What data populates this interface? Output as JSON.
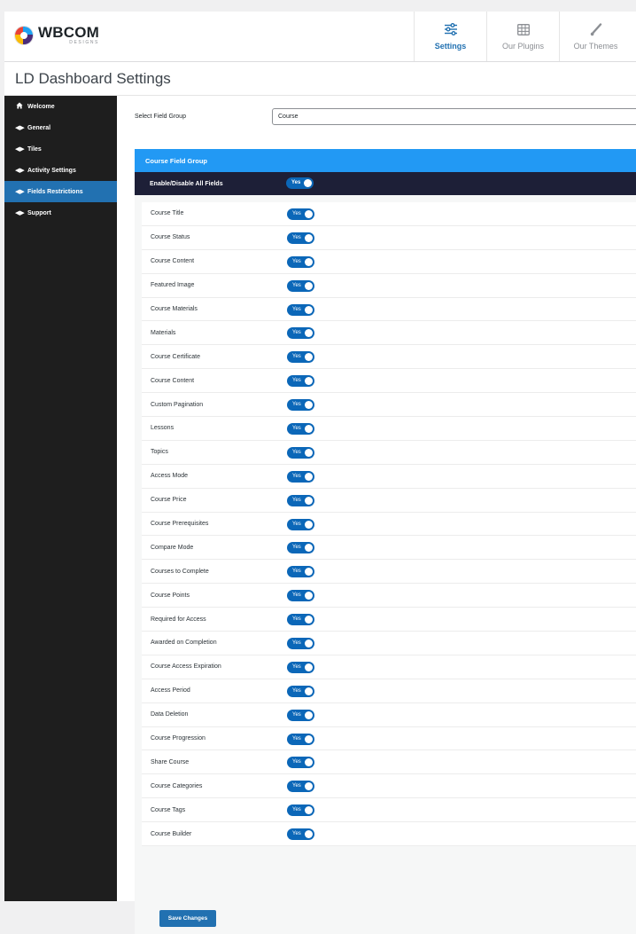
{
  "brand": {
    "name": "WBCOM",
    "tagline": "DESIGNS"
  },
  "nav": [
    {
      "label": "Settings",
      "icon": "sliders-icon",
      "active": true
    },
    {
      "label": "Our Plugins",
      "icon": "grid-icon",
      "active": false
    },
    {
      "label": "Our Themes",
      "icon": "brush-icon",
      "active": false
    }
  ],
  "page": {
    "title": "LD Dashboard Settings"
  },
  "sidebar": {
    "items": [
      {
        "label": "Welcome",
        "icon": "home-icon"
      },
      {
        "label": "General",
        "icon": "arrows-icon"
      },
      {
        "label": "Tiles",
        "icon": "arrows-icon"
      },
      {
        "label": "Activity Settings",
        "icon": "arrows-icon"
      },
      {
        "label": "Fields Restrictions",
        "icon": "arrows-icon",
        "active": true
      },
      {
        "label": "Support",
        "icon": "arrows-icon"
      }
    ]
  },
  "select_field_group": {
    "label": "Select Field Group",
    "value": "Course"
  },
  "group": {
    "title": "Course Field Group",
    "all_fields": {
      "label": "Enable/Disable All Fields",
      "toggle": "Yes"
    },
    "fields": [
      {
        "label": "Course Title",
        "toggle": "Yes"
      },
      {
        "label": "Course Status",
        "toggle": "Yes"
      },
      {
        "label": "Course Content",
        "toggle": "Yes"
      },
      {
        "label": "Featured Image",
        "toggle": "Yes"
      },
      {
        "label": "Course Materials",
        "toggle": "Yes"
      },
      {
        "label": "Materials",
        "toggle": "Yes"
      },
      {
        "label": "Course Certificate",
        "toggle": "Yes"
      },
      {
        "label": "Course Content",
        "toggle": "Yes"
      },
      {
        "label": "Custom Pagination",
        "toggle": "Yes"
      },
      {
        "label": "Lessons",
        "toggle": "Yes"
      },
      {
        "label": "Topics",
        "toggle": "Yes"
      },
      {
        "label": "Access Mode",
        "toggle": "Yes"
      },
      {
        "label": "Course Price",
        "toggle": "Yes"
      },
      {
        "label": "Course Prerequisites",
        "toggle": "Yes"
      },
      {
        "label": "Compare Mode",
        "toggle": "Yes"
      },
      {
        "label": "Courses to Complete",
        "toggle": "Yes"
      },
      {
        "label": "Course Points",
        "toggle": "Yes"
      },
      {
        "label": "Required for Access",
        "toggle": "Yes"
      },
      {
        "label": "Awarded on Completion",
        "toggle": "Yes"
      },
      {
        "label": "Course Access Expiration",
        "toggle": "Yes"
      },
      {
        "label": "Access Period",
        "toggle": "Yes"
      },
      {
        "label": "Data Deletion",
        "toggle": "Yes"
      },
      {
        "label": "Course Progression",
        "toggle": "Yes"
      },
      {
        "label": "Share Course",
        "toggle": "Yes"
      },
      {
        "label": "Course Categories",
        "toggle": "Yes"
      },
      {
        "label": "Course Tags",
        "toggle": "Yes"
      },
      {
        "label": "Course Builder",
        "toggle": "Yes"
      }
    ]
  },
  "save_button": {
    "label": "Save Changes"
  },
  "colors": {
    "accent": "#2271b1",
    "header_blue": "#2299f4",
    "dark_row": "#1d1f37",
    "toggle_on": "#0b67b8"
  }
}
